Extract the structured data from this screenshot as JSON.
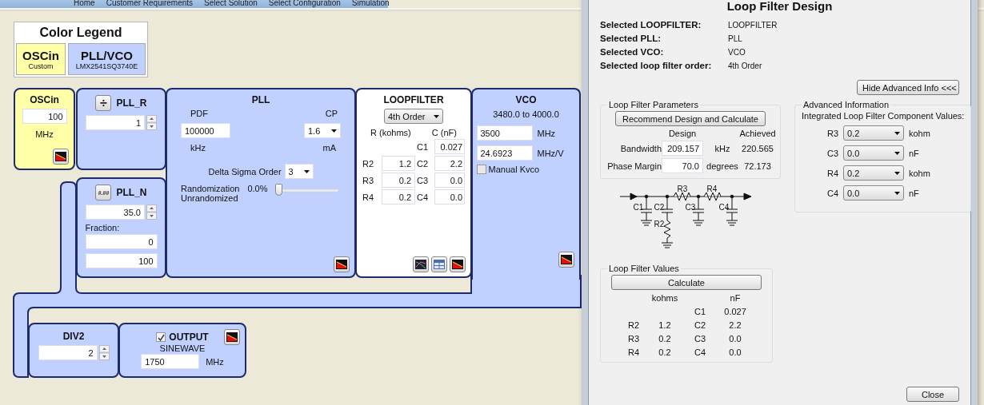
{
  "nav_tabs": [
    "Home",
    "Customer Requirements",
    "Select Solution",
    "Select Configuration",
    "Simulation"
  ],
  "legend": {
    "title": "Color Legend",
    "items": [
      {
        "name": "OSCin",
        "part": "Custom",
        "color": "#ffffa8"
      },
      {
        "name": "PLL/VCO",
        "part": "LMX2541SQ3740E",
        "color": "#c0d0ff"
      }
    ]
  },
  "oscin": {
    "title": "OSCin",
    "value": "100",
    "unit": "MHz"
  },
  "pll_r": {
    "icon": "÷",
    "title": "PLL_R",
    "value": "1"
  },
  "pll_n": {
    "icon": "#.##",
    "title": "PLL_N",
    "value": "35.0",
    "fraction_label": "Fraction:",
    "numerator": "0",
    "denominator": "100"
  },
  "pll": {
    "title": "PLL",
    "pdf_label": "PDF",
    "pdf_value": "100000",
    "pdf_unit": "kHz",
    "cp_label": "CP",
    "cp_value": "1.6",
    "cp_unit": "mA",
    "dso_label": "Delta Sigma Order",
    "dso_value": "3",
    "rand_label": "Randomization",
    "rand_state": "Unrandomized",
    "rand_reading": "0.0%",
    "level": 0
  },
  "loopfilter": {
    "title": "LOOPFILTER",
    "order": "4th Order",
    "r_header": "R (kohms)",
    "c_header": "C (nF)",
    "rows": [
      {
        "c_label": "C1",
        "c_value": "0.027"
      },
      {
        "r_label": "R2",
        "r_value": "1.2",
        "c_label": "C2",
        "c_value": "2.2"
      },
      {
        "r_label": "R3",
        "r_value": "0.2",
        "c_label": "C3",
        "c_value": "0.0"
      },
      {
        "r_label": "R4",
        "r_value": "0.2",
        "c_label": "C4",
        "c_value": "0.0"
      }
    ]
  },
  "vco": {
    "title": "VCO",
    "range": "3480.0 to 4000.0",
    "freq": "3500",
    "freq_unit": "MHz",
    "kvco": "24.6923",
    "kvco_unit": "MHz/V",
    "manual_label": "Manual Kvco",
    "manual_checked": false
  },
  "div2": {
    "title": "DIV2",
    "value": "2"
  },
  "output": {
    "title": "OUTPUT",
    "checked": true,
    "mode": "SINEWAVE",
    "value": "1750",
    "unit": "MHz"
  },
  "dialog": {
    "title": "Loop Filter Design",
    "info": [
      {
        "label": "Selected LOOPFILTER:",
        "value": "LOOPFILTER"
      },
      {
        "label": "Selected PLL:",
        "value": "PLL"
      },
      {
        "label": "Selected VCO:",
        "value": "VCO"
      },
      {
        "label": "Selected loop filter order:",
        "value": "4th Order"
      }
    ],
    "hide_button": "Hide Advanced Info <<<",
    "params": {
      "legend": "Loop Filter Parameters",
      "button": "Recommend Design and Calculate",
      "design_header": "Design",
      "achieved_header": "Achieved",
      "rows": [
        {
          "label": "Bandwidth",
          "design": "209.157",
          "unit": "kHz",
          "achieved": "220.565"
        },
        {
          "label": "Phase Margin",
          "design": "70.0",
          "unit": "degrees",
          "achieved": "72.173"
        }
      ]
    },
    "schematic_labels": [
      "R3",
      "R4",
      "C1",
      "C2",
      "C3",
      "C4",
      "R2"
    ],
    "values": {
      "legend": "Loop Filter Values",
      "button": "Calculate",
      "r_header": "kohms",
      "c_header": "nF",
      "rows": [
        {
          "c_label": "C1",
          "c_value": "0.027"
        },
        {
          "r_label": "R2",
          "r_value": "1.2",
          "c_label": "C2",
          "c_value": "2.2"
        },
        {
          "r_label": "R3",
          "r_value": "0.2",
          "c_label": "C3",
          "c_value": "0.0"
        },
        {
          "r_label": "R4",
          "r_value": "0.2",
          "c_label": "C4",
          "c_value": "0.0"
        }
      ]
    },
    "advanced": {
      "legend": "Advanced Information",
      "subtitle": "Integrated Loop Filter Component Values:",
      "rows": [
        {
          "label": "R3",
          "value": "0.2",
          "unit": "kohm"
        },
        {
          "label": "C3",
          "value": "0.0",
          "unit": "nF"
        },
        {
          "label": "R4",
          "value": "0.2",
          "unit": "kohm"
        },
        {
          "label": "C4",
          "value": "0.0",
          "unit": "nF"
        }
      ]
    },
    "close_button": "Close"
  }
}
